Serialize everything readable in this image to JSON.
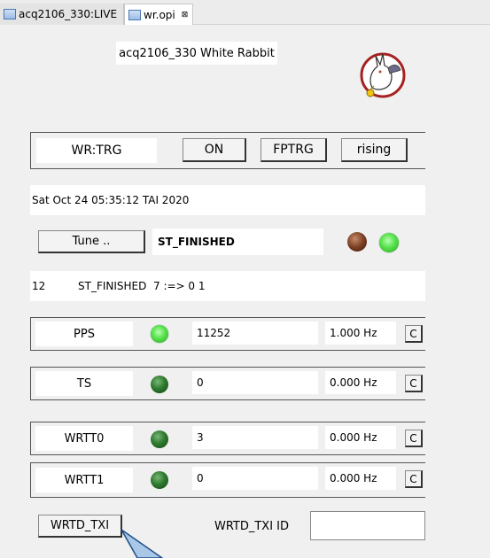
{
  "tabs": [
    {
      "label": "acq2106_330:LIVE"
    },
    {
      "label": "wr.opi",
      "close": "⊠"
    }
  ],
  "title": "acq2106_330 White Rabbit",
  "trigger": {
    "name": "WR:TRG",
    "state": "ON",
    "source": "FPTRG",
    "edge": "rising"
  },
  "timestamp": "Sat Oct 24 05:35:12 TAI 2020",
  "tune": {
    "button_label": "Tune ..",
    "status": "ST_FINISHED"
  },
  "status_line": {
    "number": "12",
    "text": "ST_FINISHED  7 :=> 0 1"
  },
  "counters": [
    {
      "name": "PPS",
      "led": "on",
      "value": "11252",
      "rate": "1.000 Hz",
      "clear_label": "C"
    },
    {
      "name": "TS",
      "led": "off",
      "value": "0",
      "rate": "0.000 Hz",
      "clear_label": "C"
    },
    {
      "name": "WRTT0",
      "led": "off",
      "value": "3",
      "rate": "0.000 Hz",
      "clear_label": "C"
    },
    {
      "name": "WRTT1",
      "led": "off",
      "value": "0",
      "rate": "0.000 Hz",
      "clear_label": "C"
    }
  ],
  "wrtd": {
    "button_label": "WRTD_TXI",
    "id_label": "WRTD_TXI ID",
    "id_value": ""
  },
  "colors": {
    "led_on": "#56e24a",
    "led_off": "#2f7a2f",
    "led_brown": "#7a3f22",
    "tab_icon": "#4a78b5"
  }
}
